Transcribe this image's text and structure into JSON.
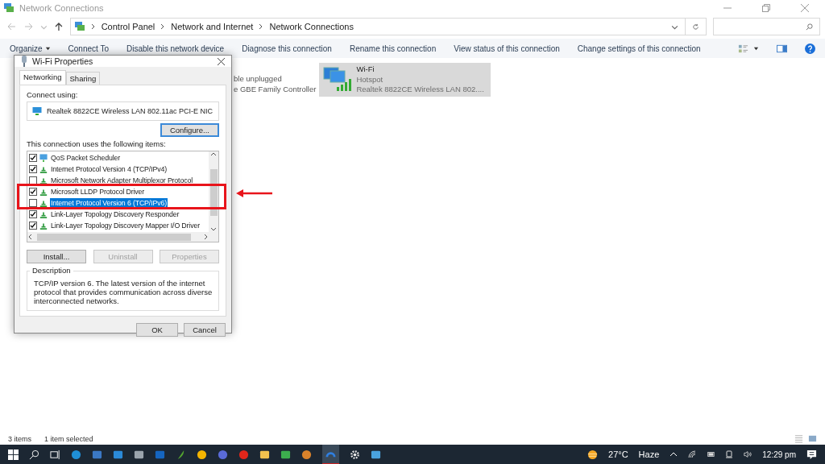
{
  "window": {
    "title": "Network Connections"
  },
  "address_bar": {
    "breadcrumbs": [
      "Control Panel",
      "Network and Internet",
      "Network Connections"
    ]
  },
  "toolbar": [
    "Organize",
    "Connect To",
    "Disable this network device",
    "Diagnose this connection",
    "Rename this connection",
    "View status of this connection",
    "Change settings of this connection"
  ],
  "connections": [
    {
      "lines": [
        "ble unplugged",
        "e GBE Family Controller"
      ],
      "selected": false
    },
    {
      "name": "Wi-Fi",
      "lines": [
        "Hotspot",
        "Realtek 8822CE Wireless LAN 802...."
      ],
      "selected": true
    }
  ],
  "dialog": {
    "title": "Wi-Fi Properties",
    "tabs": [
      {
        "label": "Networking",
        "selected": true
      },
      {
        "label": "Sharing",
        "selected": false
      }
    ],
    "connect_using_label": "Connect using:",
    "adapter": "Realtek 8822CE Wireless LAN 802.11ac PCI-E NIC",
    "configure_button": "Configure...",
    "items_label": "This connection uses the following items:",
    "items": [
      {
        "label": "QoS Packet Scheduler",
        "checked": true,
        "selected": false,
        "kind": "service"
      },
      {
        "label": "Internet Protocol Version 4 (TCP/IPv4)",
        "checked": true,
        "selected": false,
        "kind": "protocol"
      },
      {
        "label": "Microsoft Network Adapter Multiplexor Protocol",
        "checked": false,
        "selected": false,
        "kind": "protocol"
      },
      {
        "label": "Microsoft LLDP Protocol Driver",
        "checked": true,
        "selected": false,
        "kind": "protocol"
      },
      {
        "label": "Internet Protocol Version 6 (TCP/IPv6)",
        "checked": false,
        "selected": true,
        "kind": "protocol"
      },
      {
        "label": "Link-Layer Topology Discovery Responder",
        "checked": true,
        "selected": false,
        "kind": "protocol"
      },
      {
        "label": "Link-Layer Topology Discovery Mapper I/O Driver",
        "checked": true,
        "selected": false,
        "kind": "protocol"
      }
    ],
    "buttons": [
      {
        "label": "Install...",
        "disabled": false
      },
      {
        "label": "Uninstall",
        "disabled": true
      },
      {
        "label": "Properties",
        "disabled": true
      }
    ],
    "description": {
      "title": "Description",
      "text": "TCP/IP version 6. The latest version of the internet protocol that provides communication across diverse interconnected networks."
    },
    "footer_buttons": [
      "OK",
      "Cancel"
    ]
  },
  "status_bar": [
    "3 items",
    "1 item selected"
  ],
  "taskbar": {
    "temperature": "27°C",
    "condition": "Haze",
    "time": "12:29 pm"
  }
}
